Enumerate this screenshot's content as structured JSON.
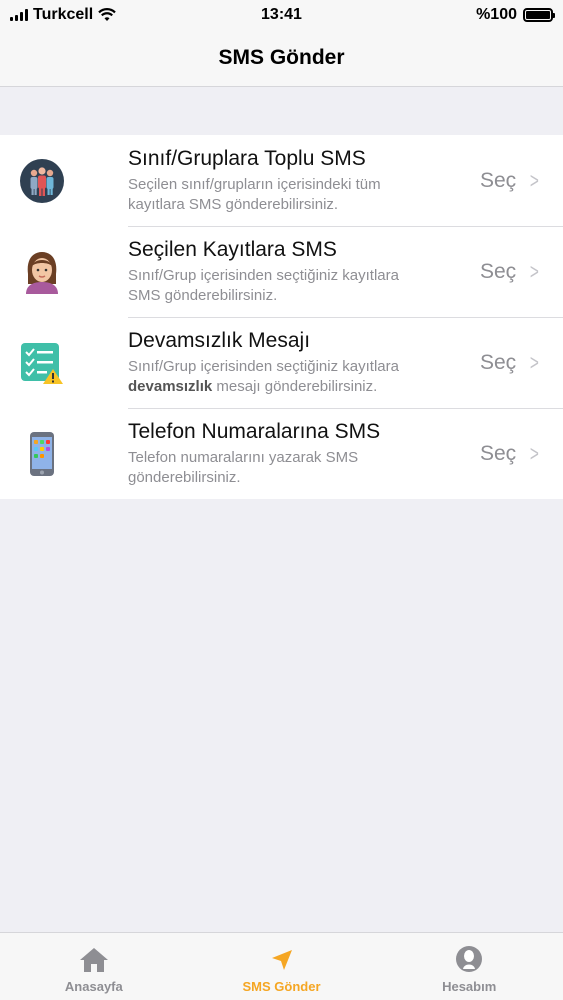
{
  "status_bar": {
    "carrier": "Turkcell",
    "time": "13:41",
    "battery": "%100"
  },
  "nav": {
    "title": "SMS Gönder"
  },
  "list": {
    "items": [
      {
        "title": "Sınıf/Gruplara Toplu SMS",
        "subtitle_line1": "Seçilen sınıf/grupların içerisindeki tüm",
        "subtitle_line2": "kayıtlara SMS gönderebilirsiniz.",
        "action": "Seç",
        "icon": "group-icon"
      },
      {
        "title": "Seçilen Kayıtlara SMS",
        "subtitle_line1": "Sınıf/Grup içerisinden seçtiğiniz kayıtlara",
        "subtitle_line2": "SMS gönderebilirsiniz.",
        "action": "Seç",
        "icon": "woman-icon"
      },
      {
        "title": "Devamsızlık Mesajı",
        "subtitle_line1": "Sınıf/Grup içerisinden seçtiğiniz kayıtlara",
        "subtitle_bold": "devamsızlık",
        "subtitle_line2_rest": " mesajı gönderebilirsiniz.",
        "action": "Seç",
        "icon": "checklist-warning-icon"
      },
      {
        "title": "Telefon Numaralarına SMS",
        "subtitle_line1": "Telefon numaralarını yazarak SMS",
        "subtitle_line2": "gönderebilirsiniz.",
        "action": "Seç",
        "icon": "phone-icon"
      }
    ]
  },
  "tabs": [
    {
      "label": "Anasayfa",
      "icon": "home-icon"
    },
    {
      "label": "SMS Gönder",
      "icon": "send-arrow-icon",
      "active": true
    },
    {
      "label": "Hesabım",
      "icon": "account-icon"
    }
  ],
  "colors": {
    "accent": "#f5a623",
    "secondary_text": "#8e8e93",
    "background": "#efeff4"
  }
}
